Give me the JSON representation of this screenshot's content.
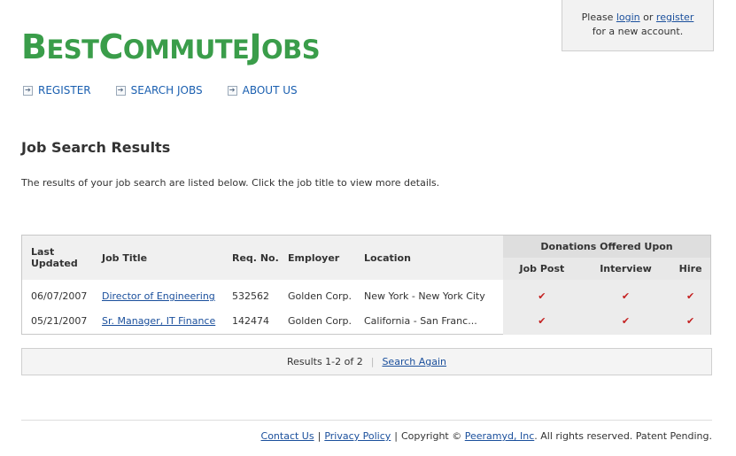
{
  "login": {
    "prefix": "Please",
    "login_link": "login",
    "or": "or",
    "register_link": "register",
    "suffix": "for a new account."
  },
  "logo": {
    "B": "B",
    "est": "EST",
    "C": "C",
    "ommute": "OMMUTE",
    "J": "J",
    "obs": "OBS"
  },
  "nav": {
    "register": "REGISTER",
    "search_jobs": "SEARCH JOBS",
    "about_us": "ABOUT US"
  },
  "page": {
    "title": "Job Search Results",
    "intro": "The results of your job search are listed below. Click the job title to view more details."
  },
  "table": {
    "headers": {
      "last_updated_1": "Last",
      "last_updated_2": "Updated",
      "job_title": "Job Title",
      "req_no": "Req. No.",
      "employer": "Employer",
      "location": "Location",
      "donations": "Donations Offered Upon",
      "job_post": "Job Post",
      "interview": "Interview",
      "hire": "Hire"
    },
    "rows": [
      {
        "date": "06/07/2007",
        "title": "Director of Engineering",
        "req": "532562",
        "employer": "Golden Corp.",
        "location": "New York - New York City",
        "job_post": "✔",
        "interview": "✔",
        "hire": "✔"
      },
      {
        "date": "05/21/2007",
        "title": "Sr. Manager, IT Finance",
        "req": "142474",
        "employer": "Golden Corp.",
        "location": "California - San Franc...",
        "job_post": "✔",
        "interview": "✔",
        "hire": "✔"
      }
    ],
    "check_color": "#c42020"
  },
  "pager": {
    "results": "Results 1-2 of 2",
    "search_again": "Search Again"
  },
  "footer": {
    "contact": "Contact Us",
    "sep1": "|",
    "privacy": "Privacy Policy",
    "sep2": "|",
    "copyright": "Copyright ©",
    "company": "Peeramyd, Inc",
    "rights": ". All rights reserved. Patent Pending."
  },
  "colors": {
    "logo_green": "#3a9d4a",
    "nav_blue": "#1a5fb0",
    "link_blue": "#1a4f9c"
  }
}
